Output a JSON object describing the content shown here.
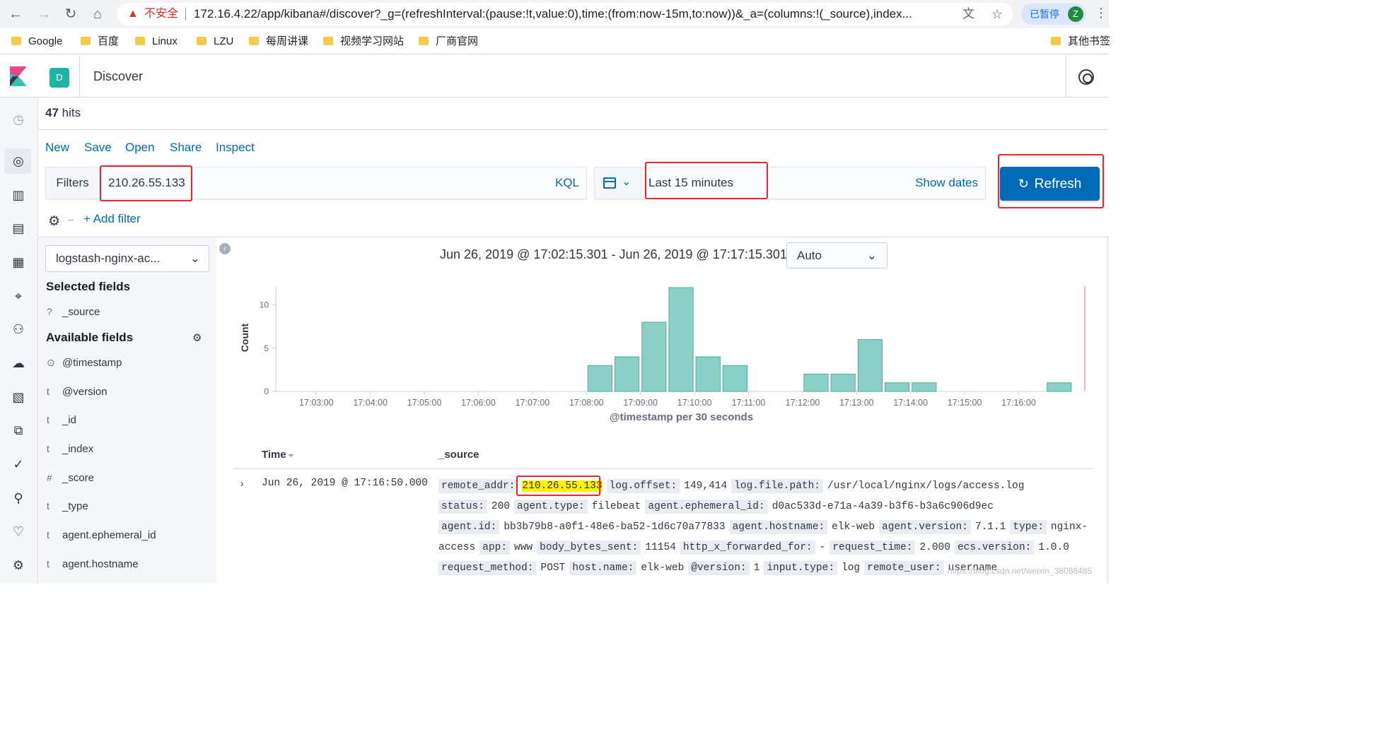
{
  "browser": {
    "insecure_label": "不安全",
    "url": "172.16.4.22/app/kibana#/discover?_g=(refreshInterval:(pause:!t,value:0),time:(from:now-15m,to:now))&_a=(columns:!(_source),index...",
    "paused_label": "已暂停",
    "profile_initial": "Z",
    "bookmarks": [
      "Google",
      "百度",
      "Linux",
      "LZU",
      "每周讲课",
      "视频学习网站",
      "厂商官网"
    ],
    "other_bookmarks": "其他书签"
  },
  "header": {
    "space_initial": "D",
    "page_title": "Discover"
  },
  "hits": {
    "count": "47",
    "label": "hits"
  },
  "top_menu": [
    "New",
    "Save",
    "Open",
    "Share",
    "Inspect"
  ],
  "query": {
    "filters_label": "Filters",
    "value": "210.26.55.133",
    "language": "KQL"
  },
  "time": {
    "range_label": "Last 15 minutes",
    "show_dates": "Show dates",
    "refresh_label": "Refresh"
  },
  "filter_bar": {
    "add_filter": "+ Add filter"
  },
  "sidebar": {
    "index_pattern": "logstash-nginx-ac...",
    "selected_heading": "Selected fields",
    "selected_fields": [
      {
        "type": "?",
        "name": "_source"
      }
    ],
    "available_heading": "Available fields",
    "available_fields": [
      {
        "type": "⊙",
        "name": "@timestamp"
      },
      {
        "type": "t",
        "name": "@version"
      },
      {
        "type": "t",
        "name": "_id"
      },
      {
        "type": "t",
        "name": "_index"
      },
      {
        "type": "#",
        "name": "_score"
      },
      {
        "type": "t",
        "name": "_type"
      },
      {
        "type": "t",
        "name": "agent.ephemeral_id"
      },
      {
        "type": "t",
        "name": "agent.hostname"
      }
    ]
  },
  "histogram": {
    "time_range_label": "Jun 26, 2019 @ 17:02:15.301 - Jun 26, 2019 @ 17:17:15.301 —",
    "interval": "Auto"
  },
  "chart_data": {
    "type": "bar",
    "ylabel": "Count",
    "xlabel": "@timestamp per 30 seconds",
    "ylim": [
      0,
      12
    ],
    "y_ticks": [
      0,
      5,
      10
    ],
    "x_ticks": [
      "17:03:00",
      "17:04:00",
      "17:05:00",
      "17:06:00",
      "17:07:00",
      "17:08:00",
      "17:09:00",
      "17:10:00",
      "17:11:00",
      "17:12:00",
      "17:13:00",
      "17:14:00",
      "17:15:00",
      "17:16:00"
    ],
    "x_start": "17:02:15",
    "bins": [
      {
        "t": "17:08:00",
        "v": 3
      },
      {
        "t": "17:08:30",
        "v": 4
      },
      {
        "t": "17:09:00",
        "v": 8
      },
      {
        "t": "17:09:30",
        "v": 12
      },
      {
        "t": "17:10:00",
        "v": 4
      },
      {
        "t": "17:10:30",
        "v": 3
      },
      {
        "t": "17:12:00",
        "v": 2
      },
      {
        "t": "17:12:30",
        "v": 2
      },
      {
        "t": "17:13:00",
        "v": 6
      },
      {
        "t": "17:13:30",
        "v": 1
      },
      {
        "t": "17:14:00",
        "v": 1
      },
      {
        "t": "17:16:30",
        "v": 1
      }
    ],
    "bar_color": "#8bd0c6",
    "bar_stroke": "#4fae9f"
  },
  "table": {
    "col_time": "Time",
    "col_source": "_source",
    "row": {
      "time": "Jun 26, 2019 @ 17:16:50.000",
      "lines": [
        [
          [
            "remote_addr:",
            "210.26.55.133",
            true
          ],
          [
            "log.offset:",
            "149,414",
            false
          ],
          [
            "log.file.path:",
            "/usr/local/nginx/logs/access.log",
            false
          ]
        ],
        [
          [
            "status:",
            "200",
            false
          ],
          [
            "agent.type:",
            "filebeat",
            false
          ],
          [
            "agent.ephemeral_id:",
            "d0ac533d-e71a-4a39-b3f6-b3a6c906d9ec",
            false
          ]
        ],
        [
          [
            "agent.id:",
            "bb3b79b8-a0f1-48e6-ba52-1d6c70a77833",
            false
          ],
          [
            "agent.hostname:",
            "elk-web",
            false
          ],
          [
            "agent.version:",
            "7.1.1",
            false
          ],
          [
            "type:",
            "nginx-",
            false
          ]
        ],
        [
          [
            "",
            "access",
            false
          ],
          [
            "app:",
            "www",
            false
          ],
          [
            "body_bytes_sent:",
            "11154",
            false
          ],
          [
            "http_x_forwarded_for:",
            "-",
            false
          ],
          [
            "request_time:",
            "2.000",
            false
          ],
          [
            "ecs.version:",
            "1.0.0",
            false
          ]
        ],
        [
          [
            "request_method:",
            "POST",
            false
          ],
          [
            "host.name:",
            "elk-web",
            false
          ],
          [
            "@version:",
            "1",
            false
          ],
          [
            "input.type:",
            "log",
            false
          ],
          [
            "remote_user:",
            "username",
            false
          ]
        ]
      ]
    }
  },
  "watermark": "https://blog.csdn.net/weixin_38088485"
}
